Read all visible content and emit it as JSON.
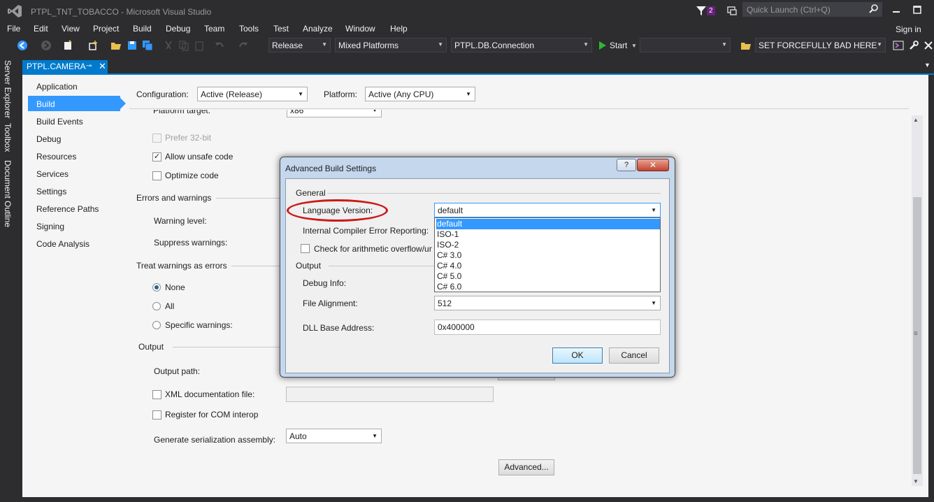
{
  "titlebar": {
    "title": "PTPL_TNT_TOBACCO - Microsoft Visual Studio",
    "notification_count": "2",
    "quick_launch_placeholder": "Quick Launch (Ctrl+Q)"
  },
  "menu": {
    "items": [
      "File",
      "Edit",
      "View",
      "Project",
      "Build",
      "Debug",
      "Team",
      "Tools",
      "Test",
      "Analyze",
      "Window",
      "Help"
    ],
    "signin": "Sign in"
  },
  "toolbar": {
    "configuration": "Release",
    "platform": "Mixed Platforms",
    "startup_project": "PTPL.DB.Connection",
    "start_label": "Start",
    "empty_combo": "",
    "find_text": "SET FORCEFULLY BAD HERE"
  },
  "toolstrip": {
    "tabs": [
      "Server Explorer",
      "Toolbox",
      "Document Outline"
    ]
  },
  "document_tab": {
    "label": "PTPL.CAMERA"
  },
  "nav": {
    "items": [
      "Application",
      "Build",
      "Build Events",
      "Debug",
      "Resources",
      "Services",
      "Settings",
      "Reference Paths",
      "Signing",
      "Code Analysis"
    ],
    "selected": "Build"
  },
  "build_page": {
    "configuration_label": "Configuration:",
    "configuration_value": "Active (Release)",
    "platform_label": "Platform:",
    "platform_value": "Active (Any CPU)",
    "platform_target_label": "Platform target:",
    "platform_target_value": "x86",
    "prefer32_label": "Prefer 32-bit",
    "allow_unsafe_label": "Allow unsafe code",
    "allow_unsafe_checked": "✓",
    "optimize_label": "Optimize code",
    "errors_header": "Errors and warnings",
    "warning_level_label": "Warning level:",
    "suppress_label": "Suppress warnings:",
    "treat_header": "Treat warnings as errors",
    "radio_none": "None",
    "radio_all": "All",
    "radio_specific": "Specific warnings:",
    "output_header": "Output",
    "output_path_label": "Output path:",
    "xml_doc_label": "XML documentation file:",
    "com_interop_label": "Register for COM interop",
    "serialization_label": "Generate serialization assembly:",
    "serialization_value": "Auto",
    "advanced_button": "Advanced..."
  },
  "dialog": {
    "title": "Advanced Build Settings",
    "help_button": "?",
    "close_button": "✕",
    "general_header": "General",
    "language_label": "Language Version:",
    "language_value": "default",
    "language_options": [
      "default",
      "ISO-1",
      "ISO-2",
      "C# 3.0",
      "C# 4.0",
      "C# 5.0",
      "C# 6.0"
    ],
    "ice_label": "Internal Compiler Error Reporting:",
    "overflow_label": "Check for arithmetic overflow/ur",
    "output_header": "Output",
    "debug_info_label": "Debug Info:",
    "file_alignment_label": "File Alignment:",
    "file_alignment_value": "512",
    "dll_base_label": "DLL Base Address:",
    "dll_base_value": "0x400000",
    "ok_button": "OK",
    "cancel_button": "Cancel"
  },
  "colors": {
    "accent": "#007acc",
    "nav_selected": "#3399ff",
    "highlight_ellipse": "#cc1a1a",
    "vs_purple": "#68217a"
  }
}
